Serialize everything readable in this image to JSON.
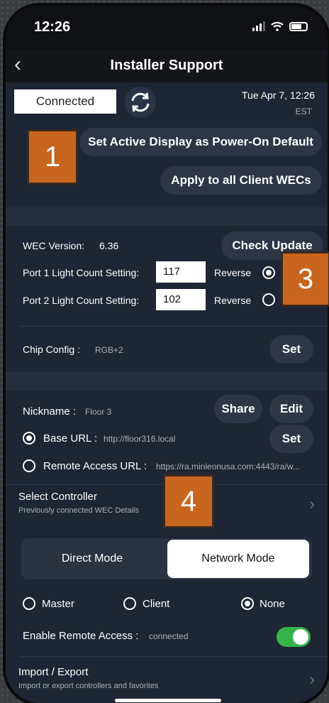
{
  "status": {
    "time": "12:26"
  },
  "nav": {
    "title": "Installer Support"
  },
  "header": {
    "connection": "Connected",
    "date": "Tue Apr 7, 12:26",
    "timezone": "EST"
  },
  "display": {
    "set_default_label": "Set Active Display as Power-On Default",
    "apply_label": "Apply to all Client WECs"
  },
  "wec": {
    "version_label": "WEC Version:",
    "version_value": "6.36",
    "check_update_label": "Check Update",
    "port1_label": "Port 1 Light Count Setting:",
    "port1_value": "117",
    "port2_label": "Port 2 Light Count Setting:",
    "port2_value": "102",
    "reverse_label": "Reverse",
    "port1_reverse": true,
    "port2_reverse": false
  },
  "chip": {
    "label": "Chip Config :",
    "value": "RGB+2",
    "set_label": "Set"
  },
  "controller": {
    "nickname_label": "Nickname :",
    "nickname_value": "Floor 3",
    "share_label": "Share",
    "edit_label": "Edit",
    "base_url_label": "Base URL :",
    "base_url_value": "http://floor316.local",
    "base_url_selected": true,
    "set_label": "Set",
    "remote_url_label": "Remote Access URL :",
    "remote_url_value": "https://ra.minleonusa.com:4443/ra/w..."
  },
  "select_controller": {
    "title": "Select Controller",
    "subtitle": "Previously connected WEC Details"
  },
  "mode": {
    "direct_label": "Direct Mode",
    "network_label": "Network Mode",
    "active": "Network Mode"
  },
  "role": {
    "master_label": "Master",
    "client_label": "Client",
    "none_label": "None",
    "selected": "None"
  },
  "remote_access": {
    "label": "Enable Remote Access :",
    "status": "connected",
    "enabled": true
  },
  "import_export": {
    "title": "Import / Export",
    "subtitle": "Import or export controllers and favorites"
  },
  "markers": {
    "m1": "1",
    "m3": "3",
    "m4": "4"
  },
  "colors": {
    "accent_green": "#35b34a",
    "marker_orange": "#c8661f",
    "background": "#1e2534"
  }
}
